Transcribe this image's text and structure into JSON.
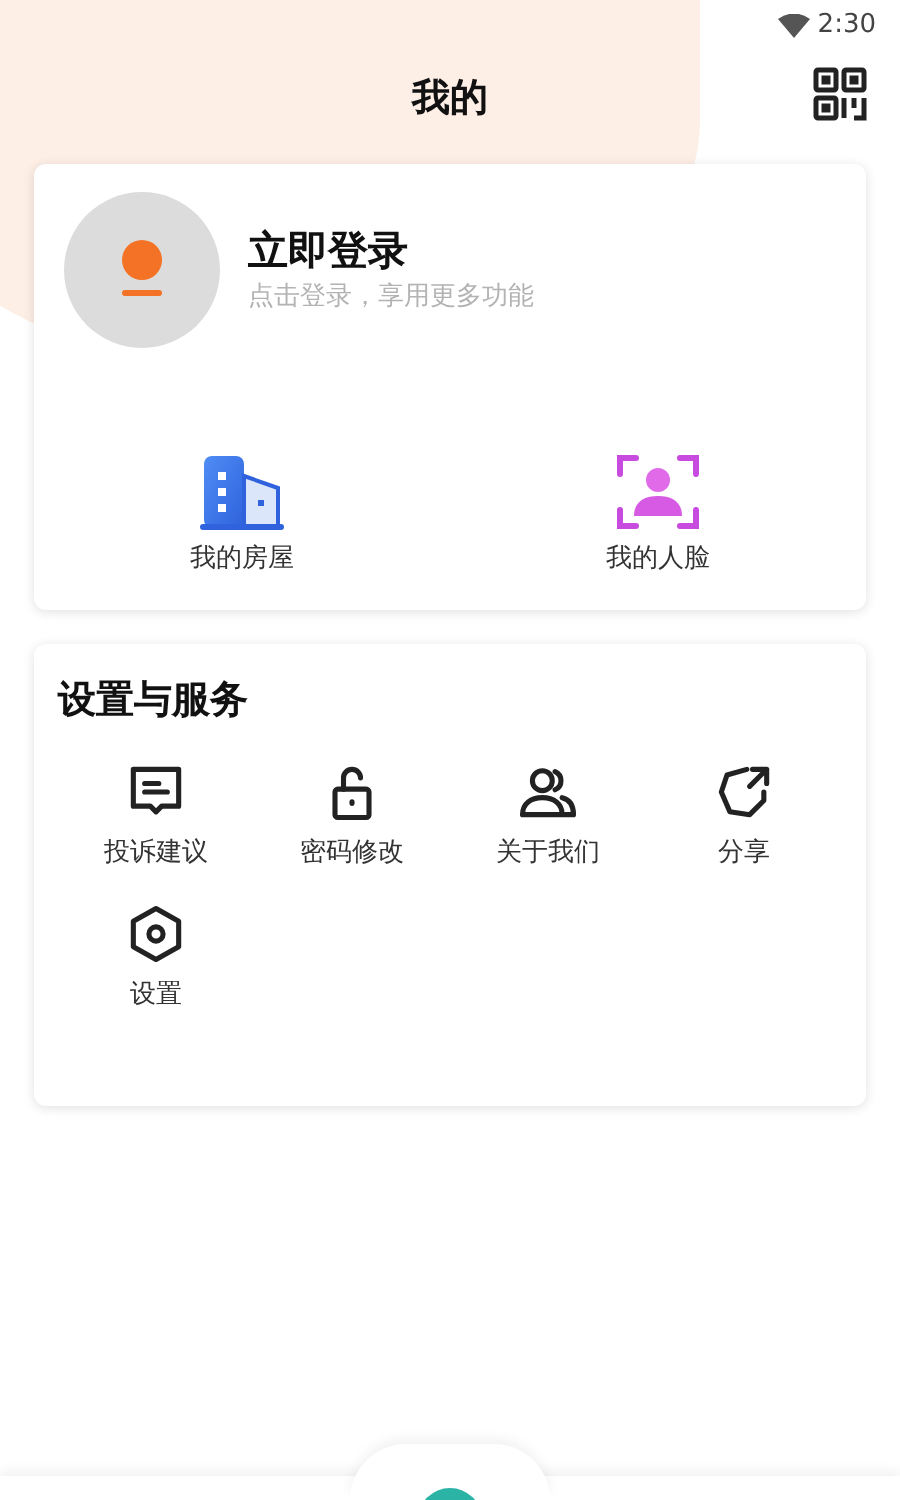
{
  "status_bar": {
    "time": "2:30"
  },
  "header": {
    "title": "我的"
  },
  "login_card": {
    "title": "立即登录",
    "subtitle": "点击登录，享用更多功能",
    "shortcuts": [
      {
        "kind": "house",
        "label": "我的房屋"
      },
      {
        "kind": "face",
        "label": "我的人脸"
      }
    ]
  },
  "services": {
    "title": "设置与服务",
    "items": [
      {
        "kind": "feedback",
        "label": "投诉建议"
      },
      {
        "kind": "lock",
        "label": "密码修改"
      },
      {
        "kind": "people",
        "label": "关于我们"
      },
      {
        "kind": "share",
        "label": "分享"
      },
      {
        "kind": "settings",
        "label": "设置"
      }
    ]
  }
}
